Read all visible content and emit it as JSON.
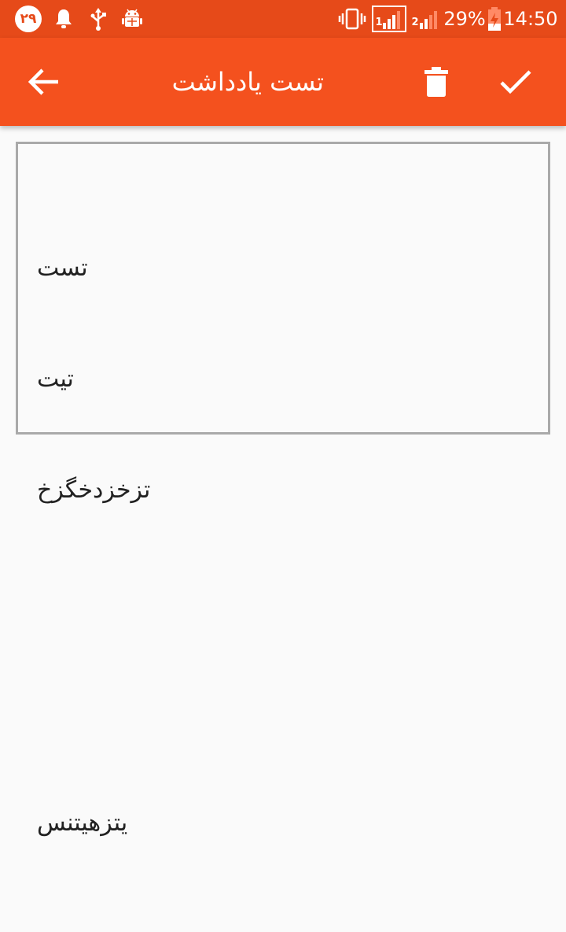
{
  "status_bar": {
    "date_badge": "۲۹",
    "battery_percent": "29%",
    "time": "14:50",
    "sim1_label": "1",
    "sim2_label": "2",
    "icons": [
      "notification-bell-icon",
      "usb-icon",
      "android-debug-icon",
      "vibrate-icon",
      "signal-sim1-icon",
      "signal-sim2-icon",
      "battery-charging-icon"
    ]
  },
  "toolbar": {
    "title": "تست یادداشت",
    "back_icon": "arrow-left-icon",
    "delete_icon": "trash-icon",
    "confirm_icon": "check-icon"
  },
  "note": {
    "lines": [
      "تست",
      "تیت",
      "تزخزدخگزخ",
      "",
      "",
      "یتزهیتنس"
    ]
  },
  "colors": {
    "status_bar": "#e64a19",
    "toolbar": "#f4511e",
    "background": "#fafafa",
    "note_border": "#a9a9a9",
    "text": "#212121"
  }
}
